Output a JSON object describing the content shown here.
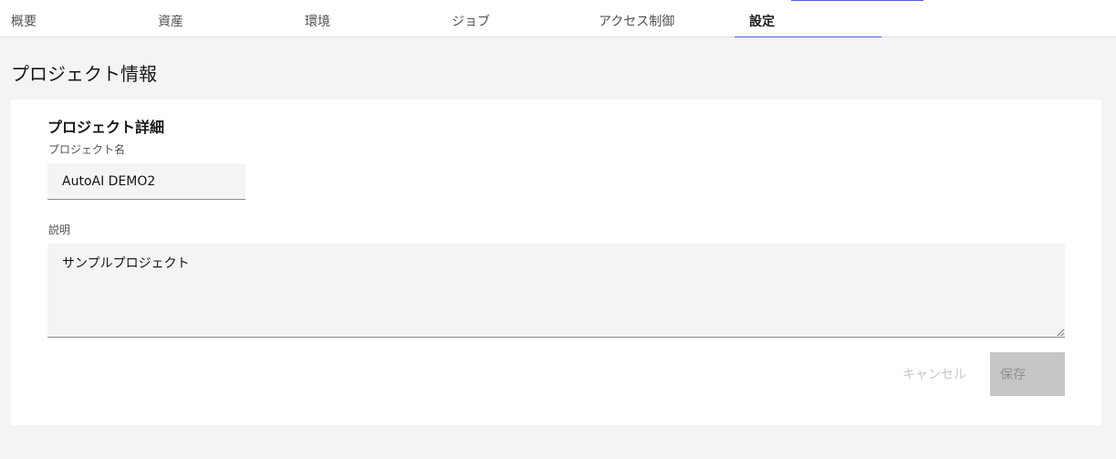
{
  "tabs": [
    {
      "label": "概要"
    },
    {
      "label": "資産"
    },
    {
      "label": "環境"
    },
    {
      "label": "ジョブ"
    },
    {
      "label": "アクセス制御"
    },
    {
      "label": "設定",
      "selected": true
    }
  ],
  "page": {
    "title": "プロジェクト情報"
  },
  "details": {
    "section_title": "プロジェクト詳細",
    "name_label": "プロジェクト名",
    "name_value": "AutoAI DEMO2",
    "description_label": "説明",
    "description_value": "サンプルプロジェクト",
    "cancel_label": "キャンセル",
    "save_label": "保存"
  },
  "colors": {
    "accent": "#4f5fd6",
    "field_background": "#f4f4f4",
    "disabled": "#c6c6c6"
  }
}
